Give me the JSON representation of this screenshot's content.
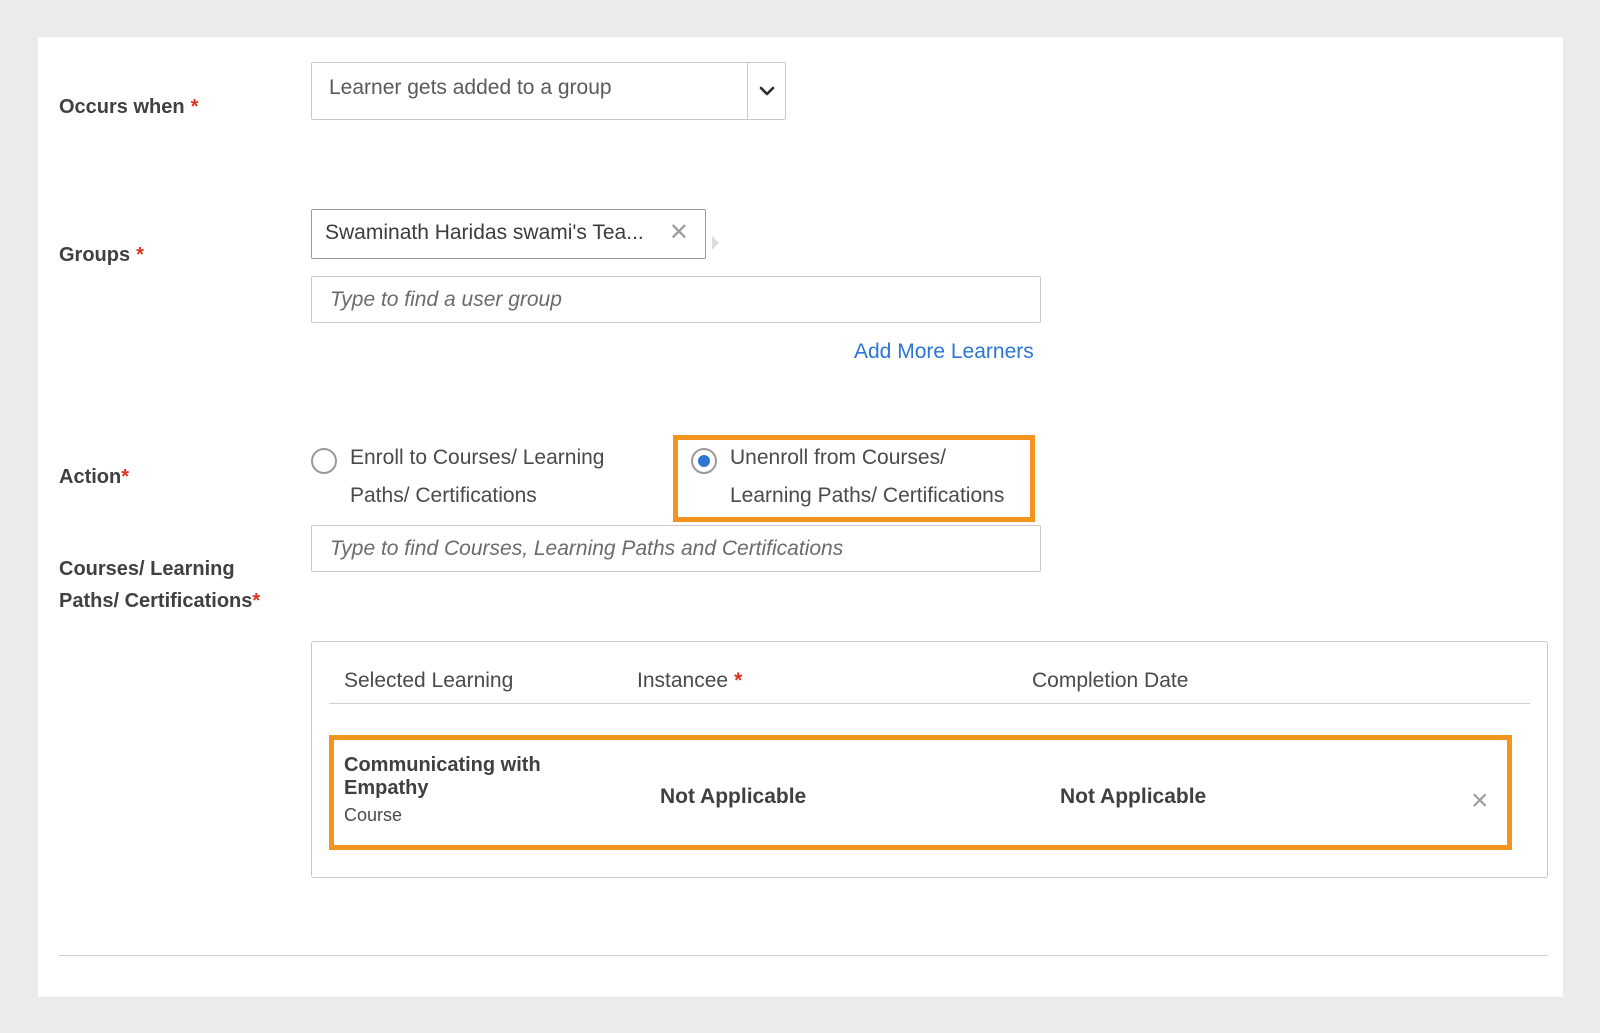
{
  "form": {
    "occurs_when": {
      "label": "Occurs when",
      "required_mark": "*",
      "selected_value": "Learner gets added to a group"
    },
    "groups": {
      "label": "Groups",
      "required_mark": "*",
      "selected_chip": "Swaminath Haridas swami's Tea...",
      "search_placeholder": "Type to find a user group",
      "add_more_link": "Add More Learners"
    },
    "action": {
      "label": "Action",
      "required_mark": "*",
      "options": [
        {
          "line1": "Enroll to Courses/ Learning",
          "line2": "Paths/ Certifications",
          "checked": false
        },
        {
          "line1": "Unenroll from Courses/",
          "line2": "Learning Paths/ Certifications",
          "checked": true
        }
      ]
    },
    "learning": {
      "label_line1": "Courses/ Learning",
      "label_line2": "Paths/ Certifications",
      "required_mark": "*",
      "search_placeholder": "Type to find Courses, Learning Paths and Certifications"
    },
    "table": {
      "headers": {
        "selected_learning": "Selected Learning",
        "instance": "Instancee",
        "instance_required": "*",
        "completion_date": "Completion Date"
      },
      "rows": [
        {
          "title_line1": "Communicating with",
          "title_line2": "Empathy",
          "type": "Course",
          "instance": "Not Applicable",
          "completion_date": "Not Applicable"
        }
      ]
    }
  },
  "colors": {
    "highlight": "#f2941d",
    "link": "#2c75d6",
    "required": "#e0311e",
    "radio_selected": "#2c75d6"
  },
  "icons": {
    "select_caret": "chevron-down-icon",
    "chip_remove": "close-icon",
    "row_remove": "close-icon"
  }
}
